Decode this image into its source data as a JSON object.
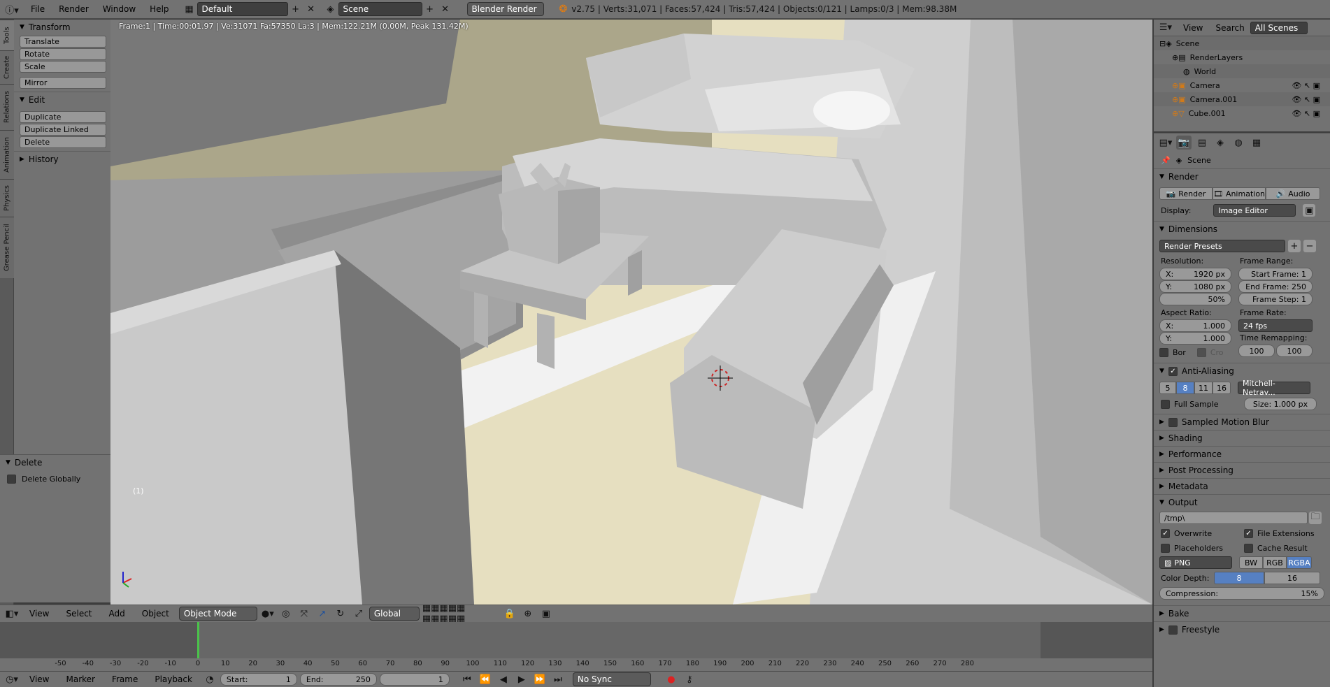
{
  "topbar": {
    "menus": [
      "File",
      "Render",
      "Window",
      "Help"
    ],
    "layout": "Default",
    "scene": "Scene",
    "engine": "Blender Render",
    "stats": "v2.75 | Verts:31,071 | Faces:57,424 | Tris:57,424 | Objects:0/121 | Lamps:0/3 | Mem:98.38M"
  },
  "tool_tabs": [
    "Tools",
    "Create",
    "Relations",
    "Animation",
    "Physics",
    "Grease Pencil"
  ],
  "shelf": {
    "transform_title": "Transform",
    "transform_buttons": [
      "Translate",
      "Rotate",
      "Scale"
    ],
    "mirror": "Mirror",
    "edit_title": "Edit",
    "edit_buttons": [
      "Duplicate",
      "Duplicate Linked",
      "Delete"
    ],
    "history_title": "History"
  },
  "delete_panel": {
    "title": "Delete",
    "option": "Delete Globally",
    "checked": false
  },
  "viewport": {
    "info": "Frame:1 | Time:00:01.97 | Ve:31071 Fa:57350 La:3 | Mem:122.21M (0.00M, Peak 131.42M)",
    "frame_label": "(1)"
  },
  "view3d_header": {
    "menus": [
      "View",
      "Select",
      "Add",
      "Object"
    ],
    "mode": "Object Mode",
    "orientation": "Global"
  },
  "timeline": {
    "ticks": [
      "-50",
      "-40",
      "-30",
      "-20",
      "-10",
      "0",
      "10",
      "20",
      "30",
      "40",
      "50",
      "60",
      "70",
      "80",
      "90",
      "100",
      "110",
      "120",
      "130",
      "140",
      "150",
      "160",
      "170",
      "180",
      "190",
      "200",
      "210",
      "220",
      "230",
      "240",
      "250",
      "260",
      "270",
      "280"
    ],
    "current_frame": 1
  },
  "timeline_header": {
    "menus": [
      "View",
      "Marker",
      "Frame",
      "Playback"
    ],
    "start_label": "Start:",
    "start": "1",
    "end_label": "End:",
    "end": "250",
    "current": "1",
    "sync": "No Sync"
  },
  "outliner": {
    "menus": [
      "View",
      "Search"
    ],
    "filter": "All Scenes",
    "items": [
      "Scene",
      "RenderLayers",
      "World",
      "Camera",
      "Camera.001",
      "Cube.001"
    ]
  },
  "properties": {
    "context": "Scene",
    "render_title": "Render",
    "render_buttons": [
      "Render",
      "Animation",
      "Audio"
    ],
    "display_label": "Display:",
    "display_value": "Image Editor",
    "dimensions_title": "Dimensions",
    "render_presets": "Render Presets",
    "resolution_label": "Resolution:",
    "res_x": "1920 px",
    "res_y": "1080 px",
    "res_pct": "50%",
    "frame_range_label": "Frame Range:",
    "start_frame": "Start Frame: 1",
    "end_frame": "End Frame: 250",
    "frame_step": "Frame Step: 1",
    "aspect_label": "Aspect Ratio:",
    "aspect_x": "1.000",
    "aspect_y": "1.000",
    "frame_rate_label": "Frame Rate:",
    "frame_rate": "24 fps",
    "time_remap_label": "Time Remapping:",
    "remap_old": "100",
    "remap_new": "100",
    "bor": "Bor",
    "cro": "Cro",
    "aa_title": "Anti-Aliasing",
    "aa_samples": [
      "5",
      "8",
      "11",
      "16"
    ],
    "aa_filter": "Mitchell-Netrav...",
    "full_sample": "Full Sample",
    "aa_size": "Size: 1.000 px",
    "sections": [
      "Sampled Motion Blur",
      "Shading",
      "Performance",
      "Post Processing",
      "Metadata"
    ],
    "output_title": "Output",
    "output_path": "/tmp\\",
    "overwrite": "Overwrite",
    "file_ext": "File Extensions",
    "placeholders": "Placeholders",
    "cache_result": "Cache Result",
    "format": "PNG",
    "color_modes": [
      "BW",
      "RGB",
      "RGBA"
    ],
    "color_depth_label": "Color Depth:",
    "depth_8": "8",
    "depth_16": "16",
    "compression": "Compression:",
    "compression_value": "15%",
    "bake_title": "Bake",
    "freestyle_title": "Freestyle"
  }
}
